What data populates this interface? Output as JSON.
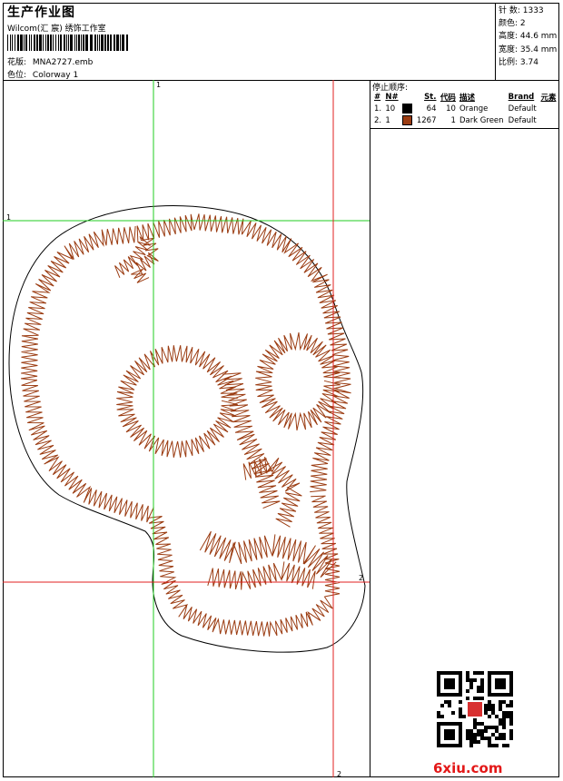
{
  "header": {
    "title": "生产作业图",
    "company": "Wilcom(汇 宸) 绣饰工作室",
    "design_label": "花版:",
    "design_file": "MNA2727.emb",
    "colorway_label": "色位:",
    "colorway": "Colorway 1"
  },
  "stats": {
    "stitches": "针 数: 1333",
    "colors": "颜色: 2",
    "height": "高度: 44.6 mm",
    "width": "宽度: 35.4 mm",
    "scale": "比例: 3.74"
  },
  "stop_sequence": {
    "title": "停止顺序:",
    "headers": [
      "#",
      "N#",
      "St.",
      "代码",
      "描述",
      "Brand",
      "元素"
    ],
    "rows": [
      {
        "num": "1.",
        "needle": "10",
        "color": "#000000",
        "stitches": "64",
        "code": "10",
        "desc": "Orange",
        "brand": "Default"
      },
      {
        "num": "2.",
        "needle": "1",
        "color": "#9b3c12",
        "stitches": "1267",
        "code": "1",
        "desc": "Dark Green",
        "brand": "Default"
      }
    ]
  },
  "guides": {
    "green_v": "1",
    "green_h": "1",
    "red_v": "2",
    "red_h": "2"
  },
  "colors": {
    "stitch": "#9b3c12",
    "guide_green": "#22cc22",
    "guide_red": "#e02020"
  },
  "watermark": "6xiu.com"
}
